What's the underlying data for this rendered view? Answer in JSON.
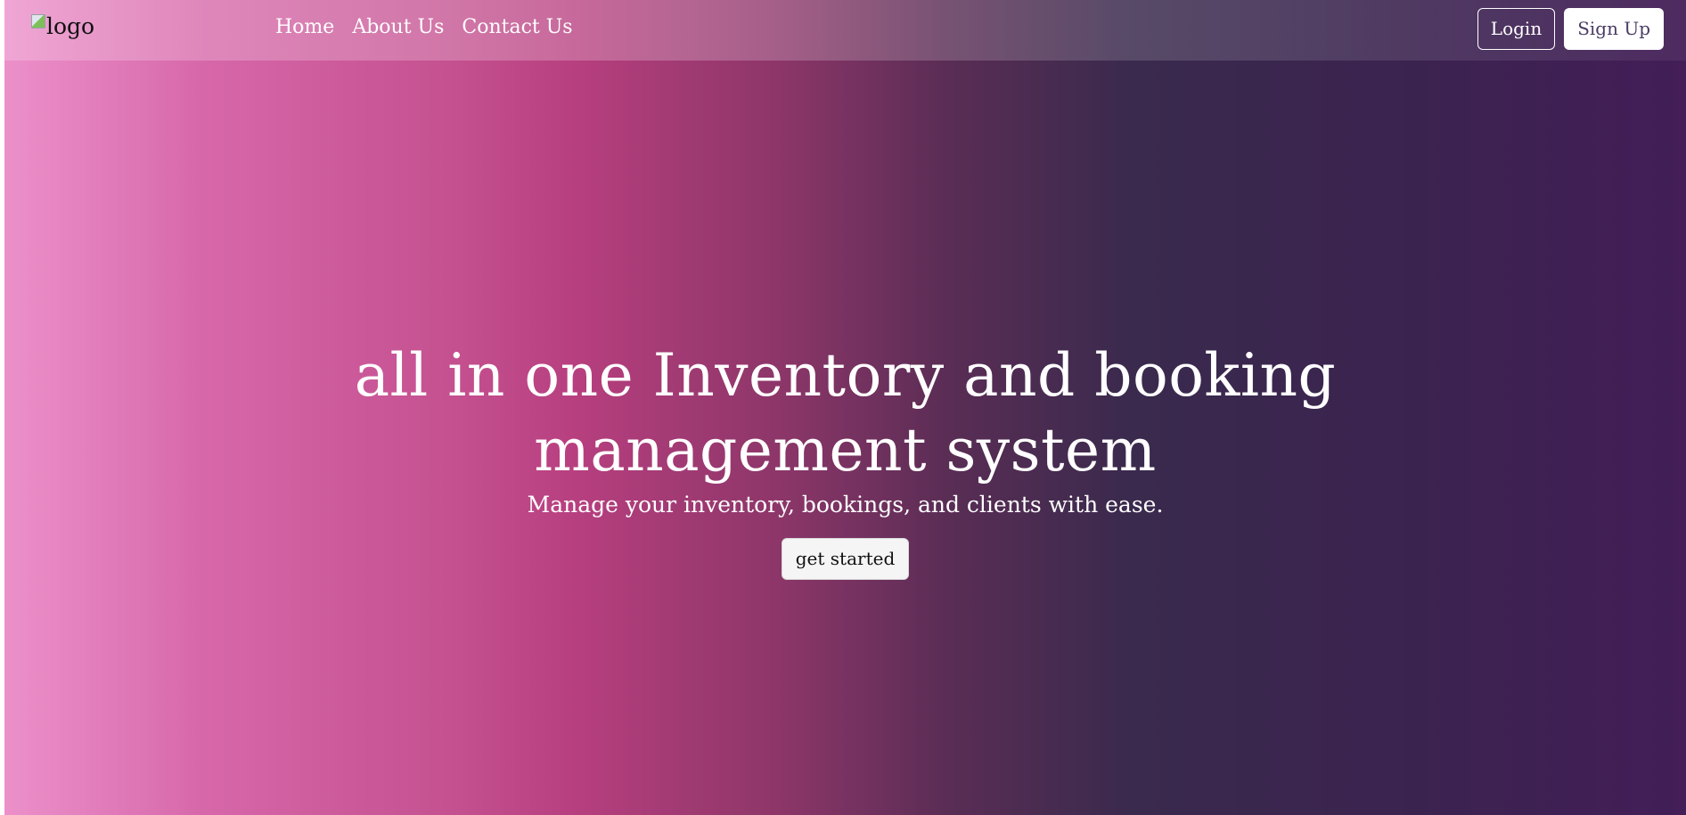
{
  "navbar": {
    "logo_alt": "logo",
    "links": [
      {
        "label": "Home"
      },
      {
        "label": "About Us"
      },
      {
        "label": "Contact Us"
      }
    ],
    "login_label": "Login",
    "signup_label": "Sign Up"
  },
  "hero": {
    "title": "all in one Inventory and booking management system",
    "subtitle": "Manage your inventory, bookings, and clients with ease.",
    "cta_label": "get started"
  },
  "colors": {
    "gradient_start": "#ec90ca",
    "gradient_mid": "#b73f7f",
    "gradient_dark": "#3a2a4d",
    "gradient_end": "#431e57",
    "signup_text": "#4a3b63"
  }
}
